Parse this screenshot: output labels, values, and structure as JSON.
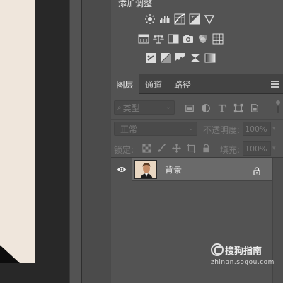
{
  "adjustments": {
    "title": "添加调整",
    "row1": [
      "brightness-contrast-icon",
      "levels-icon",
      "curves-icon",
      "exposure-icon",
      "vibrance-icon"
    ],
    "row2": [
      "hue-saturation-icon",
      "color-balance-icon",
      "black-white-icon",
      "photo-filter-icon",
      "channel-mixer-icon",
      "color-lookup-icon"
    ],
    "row3": [
      "invert-icon",
      "posterize-icon",
      "threshold-icon",
      "selective-color-icon",
      "gradient-map-icon"
    ]
  },
  "layers_panel": {
    "tabs": [
      {
        "label": "图层",
        "active": true
      },
      {
        "label": "通道",
        "active": false
      },
      {
        "label": "路径",
        "active": false
      }
    ],
    "filter": {
      "kind_label": "类型",
      "icons": [
        "pixel-filter-icon",
        "adjustment-filter-icon",
        "type-filter-icon",
        "shape-filter-icon",
        "smart-object-filter-icon"
      ]
    },
    "blend_mode": "正常",
    "opacity_label": "不透明度:",
    "opacity_value": "100%",
    "lock_label": "锁定:",
    "lock_icons": [
      "lock-transparent-icon",
      "lock-image-icon",
      "lock-position-icon",
      "lock-artboard-icon",
      "lock-all-icon"
    ],
    "fill_label": "填充:",
    "fill_value": "100%",
    "layers": [
      {
        "name": "背景",
        "visible": true,
        "locked": true
      }
    ]
  },
  "watermark": {
    "title": "搜狗指南",
    "url": "zhinan.sogou.com"
  },
  "colors": {
    "panel_bg": "#535353",
    "tab_bar_bg": "#434343",
    "selected_layer_bg": "#6a6a6a",
    "canvas_paper": "#efe6dc"
  }
}
